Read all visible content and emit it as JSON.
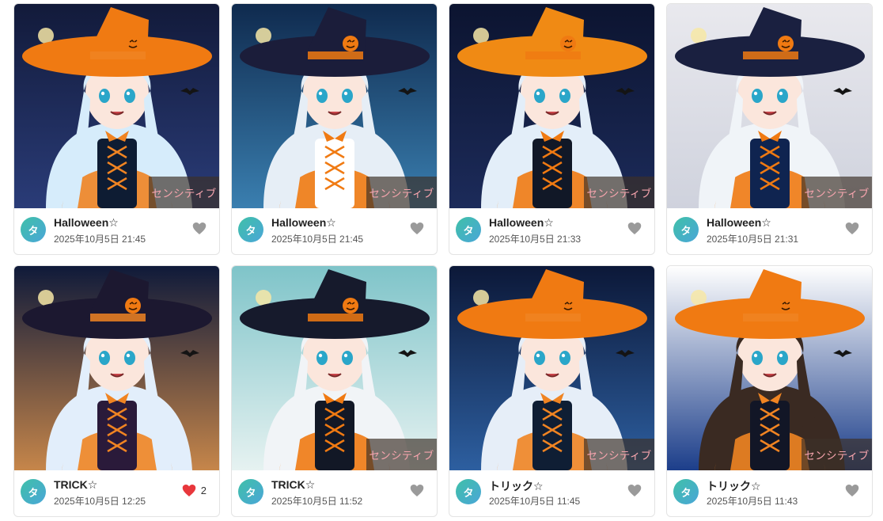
{
  "sensitive_label": "センシティブ",
  "colors": {
    "heart_default": "#9a9a9a",
    "heart_liked": "#e8373c",
    "sensitive_text": "#f6a4ad",
    "avatar_gradient": [
      "#3fc0a8",
      "#4aa6d8"
    ]
  },
  "posts": [
    {
      "title": "Halloween☆",
      "date": "2025年10月5日 21:45",
      "avatar": "タ",
      "liked": false,
      "likes": "",
      "sensitive": true,
      "art": {
        "bg1": "#121a3a",
        "bg2": "#2a3c78",
        "hat": "#f07a12",
        "hair": "#d6ecfb",
        "outfit": "#0e1c33",
        "accent": "#f08422"
      }
    },
    {
      "title": "Halloween☆",
      "date": "2025年10月5日 21:45",
      "avatar": "タ",
      "liked": false,
      "likes": "",
      "sensitive": true,
      "art": {
        "bg1": "#0f2a4e",
        "bg2": "#3a7fb0",
        "hat": "#1b1d3a",
        "hair": "#e6eef6",
        "outfit": "#ffffff",
        "accent": "#f07a12"
      }
    },
    {
      "title": "Halloween☆",
      "date": "2025年10月5日 21:33",
      "avatar": "タ",
      "liked": false,
      "likes": "",
      "sensitive": true,
      "art": {
        "bg1": "#0c1430",
        "bg2": "#1c2b5a",
        "hat": "#f08a14",
        "hair": "#e3eef9",
        "outfit": "#111827",
        "accent": "#f07a12"
      }
    },
    {
      "title": "Halloween☆",
      "date": "2025年10月5日 21:31",
      "avatar": "タ",
      "liked": false,
      "likes": "",
      "sensitive": true,
      "art": {
        "bg1": "#e9e9ee",
        "bg2": "#cfd2dd",
        "hat": "#1a2040",
        "hair": "#f0f4f8",
        "outfit": "#0f2450",
        "accent": "#f07a12"
      }
    },
    {
      "title": "TRICK☆",
      "date": "2025年10月5日 12:25",
      "avatar": "タ",
      "liked": true,
      "likes": "2",
      "sensitive": false,
      "art": {
        "bg1": "#0f1a3a",
        "bg2": "#c6864a",
        "hat": "#1c1830",
        "hair": "#e2eefb",
        "outfit": "#2a1a3a",
        "accent": "#f08422"
      }
    },
    {
      "title": "TRICK☆",
      "date": "2025年10月5日 11:52",
      "avatar": "タ",
      "liked": false,
      "likes": "",
      "sensitive": true,
      "art": {
        "bg1": "#7fc4c9",
        "bg2": "#e6f2f1",
        "hat": "#161a2c",
        "hair": "#f1f4f7",
        "outfit": "#121826",
        "accent": "#f07a12"
      }
    },
    {
      "title": "トリック☆",
      "date": "2025年10月5日 11:45",
      "avatar": "タ",
      "liked": false,
      "likes": "",
      "sensitive": true,
      "art": {
        "bg1": "#0c1838",
        "bg2": "#2d5fa0",
        "hat": "#f07a12",
        "hair": "#e6eef8",
        "outfit": "#0f1e34",
        "accent": "#f08422"
      }
    },
    {
      "title": "トリック☆",
      "date": "2025年10月5日 11:43",
      "avatar": "タ",
      "liked": false,
      "likes": "",
      "sensitive": true,
      "art": {
        "bg1": "#ffffff",
        "bg2": "#1c3e8a",
        "hat": "#f07a12",
        "hair": "#3a2a22",
        "outfit": "#121626",
        "accent": "#f08422"
      }
    }
  ]
}
